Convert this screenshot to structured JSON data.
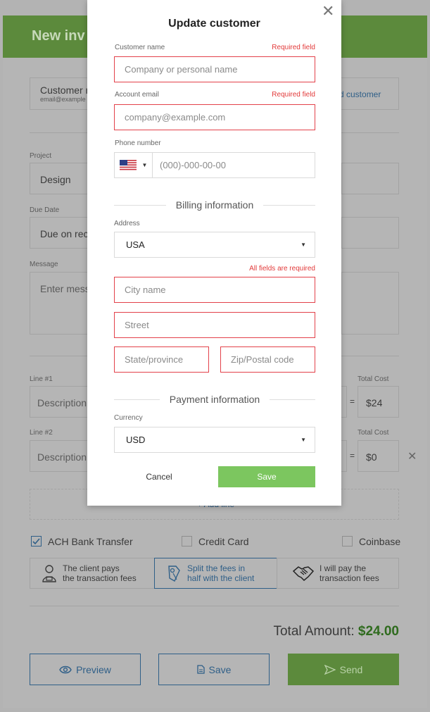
{
  "background": {
    "invoice_title": "New inv",
    "customer_name": "Customer n",
    "customer_email": "email@example",
    "add_customer": "d customer",
    "project_label": "Project",
    "project_value": "Design",
    "due_date_label": "Due Date",
    "due_date_value": "Due on rec",
    "message_label": "Message",
    "message_placeholder": "Enter mess",
    "line1_label": "Line #1",
    "line2_label": "Line #2",
    "description_placeholder": "Description",
    "total_cost_label": "Total Cost",
    "line1_total": "$24",
    "line2_total": "$0",
    "equals": "=",
    "add_line": "+ Add line",
    "payment_methods": [
      {
        "label": "ACH Bank Transfer",
        "checked": true
      },
      {
        "label": "Credit Card",
        "checked": false
      },
      {
        "label": "Coinbase",
        "checked": false
      }
    ],
    "fee_options": [
      {
        "line1": "The client pays",
        "line2": "the transaction fees",
        "icon": "person-icon",
        "selected": false
      },
      {
        "line1": "Split the fees in",
        "line2": "half with the client",
        "icon": "split-icon",
        "selected": true
      },
      {
        "line1": "I will pay the",
        "line2": "transaction fees",
        "icon": "handshake-icon",
        "selected": false
      }
    ],
    "total_label": "Total Amount:",
    "total_value": "$24.00",
    "preview_button": "Preview",
    "save_button": "Save",
    "send_button": "Send"
  },
  "modal": {
    "title": "Update customer",
    "customer_name_label": "Customer name",
    "customer_name_required": "Required field",
    "customer_name_placeholder": "Company or personal name",
    "email_label": "Account email",
    "email_required": "Required field",
    "email_placeholder": "company@example.com",
    "phone_label": "Phone number",
    "phone_placeholder": "(000)-000-00-00",
    "billing_heading": "Billing information",
    "address_label": "Address",
    "country_value": "USA",
    "all_required": "All fields are required",
    "city_placeholder": "City name",
    "street_placeholder": "Street",
    "state_placeholder": "State/province",
    "zip_placeholder": "Zip/Postal code",
    "payment_heading": "Payment information",
    "currency_label": "Currency",
    "currency_value": "USD",
    "cancel_button": "Cancel",
    "save_button": "Save",
    "accent_color": "#7cc65f",
    "error_color": "#e3414a"
  }
}
